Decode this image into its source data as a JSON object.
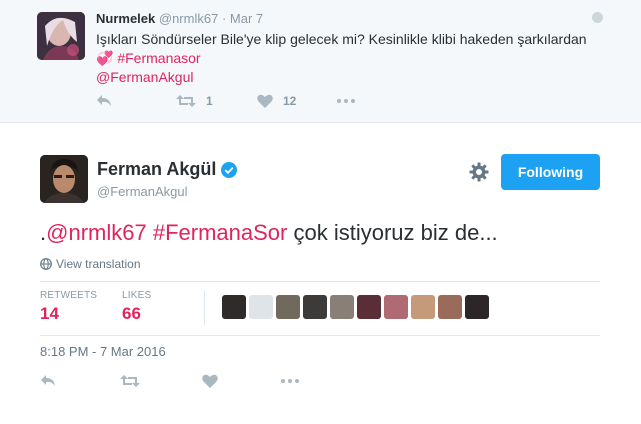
{
  "parent_tweet": {
    "name": "Nurmelek",
    "handle": "@nrmlk67",
    "separator": "·",
    "date": "Mar 7",
    "text_main": "Işıkları Söndürseler Bile'ye klip gelecek mi? Kesinlikle klibi hakeden şarkılardan",
    "emoji": "💞",
    "hashtag": "#Fermanasor",
    "mention": "@FermanAkgul",
    "retweet_count": "1",
    "like_count": "12"
  },
  "main_tweet": {
    "name": "Ferman Akgül",
    "handle": "@FermanAkgul",
    "follow_label": "Following",
    "text_prefix": ".",
    "text_mention": "@nrmlk67",
    "text_hashtag": "#FermanaSor",
    "text_rest": "çok istiyoruz biz de...",
    "view_translation": "View translation",
    "retweets_label": "RETWEETS",
    "retweets_value": "14",
    "likes_label": "LIKES",
    "likes_value": "66",
    "liker_avatar_count": 10,
    "timestamp": "8:18 PM - 7 Mar 2016"
  },
  "icons": {
    "reply": "reply-icon",
    "retweet": "retweet-icon",
    "like": "heart-icon",
    "more": "more-icon",
    "verified": "verified-badge-icon",
    "settings": "gear-icon",
    "translate": "globe-icon"
  },
  "colors": {
    "link": "#e0245e",
    "follow_button": "#1da1f2",
    "muted": "#8899a6",
    "parent_background": "#f5f8fa"
  }
}
